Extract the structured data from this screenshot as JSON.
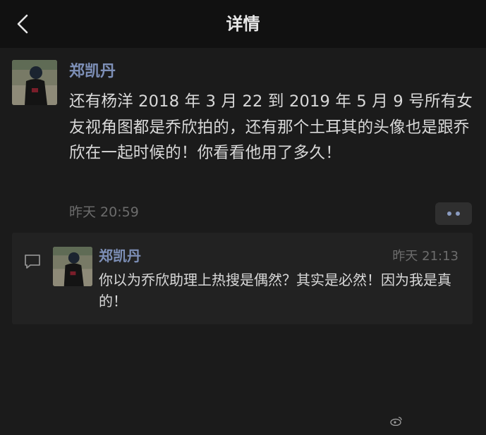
{
  "header": {
    "title": "详情",
    "back_icon": "chevron-left-icon"
  },
  "post": {
    "author": "郑凯丹",
    "text": "还有杨洋 2018 年 3 月 22 到 2019 年 5 月 9 号所有女友视角图都是乔欣拍的，还有那个土耳其的头像也是跟乔欣在一起时候的！你看看他用了多久！",
    "time": "昨天 20:59",
    "more_icon": "more-dots-icon"
  },
  "comment": {
    "icon": "comment-bubble-icon",
    "author": "郑凯丹",
    "time": "昨天 21:13",
    "text": "你以为乔欣助理上热搜是偶然？其实是必然！因为我是真的！"
  },
  "colors": {
    "background": "#1b1b1b",
    "header_bg": "#111111",
    "name_blue": "#7d8fb7",
    "text": "#d9d9d9",
    "muted": "#6c6c6c",
    "comment_bg": "#222222"
  }
}
